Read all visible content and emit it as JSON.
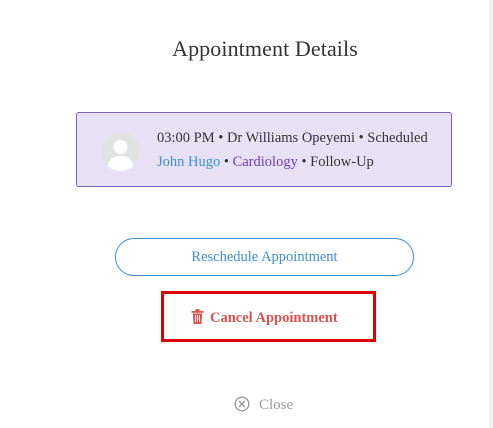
{
  "modal": {
    "title": "Appointment Details"
  },
  "appointment": {
    "time": "03:00 PM",
    "doctor": "Dr Williams Opeyemi",
    "status": "Scheduled",
    "patient": "John Hugo",
    "specialty": "Cardiology",
    "type": "Follow-Up",
    "separator": "•",
    "avatar_icon": "user-avatar-icon"
  },
  "actions": {
    "reschedule_label": "Reschedule Appointment",
    "cancel_label": "Cancel Appointment",
    "cancel_icon": "trash-icon",
    "close_label": "Close",
    "close_icon": "circle-x-icon"
  },
  "colors": {
    "card_background": "#e8e1f5",
    "card_border": "#7b5fc0",
    "link_blue": "#3d8fd6",
    "specialty_purple": "#6a3fb5",
    "danger_red": "#d9534f",
    "highlight_red": "#e00000",
    "muted_gray": "#9a9a9a"
  }
}
